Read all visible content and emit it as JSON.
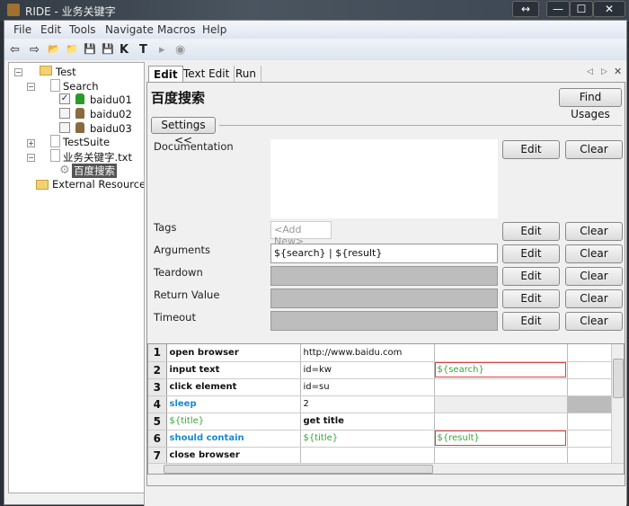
{
  "window": {
    "title": "RIDE - 业务关键字",
    "buttons": [
      "↔",
      "—",
      "☐",
      "✕"
    ]
  },
  "menu": [
    "File",
    "Edit",
    "Tools",
    "Navigate",
    "Macros",
    "Help"
  ],
  "toolbar": {
    "icons": [
      "back-arrow",
      "forward-arrow",
      "open-folder",
      "open-directory",
      "save",
      "save-all",
      "search-keywords",
      "search-tests",
      "run",
      "stop"
    ],
    "glyphs": [
      "⇦",
      "⇨",
      "📂",
      "📁",
      "💾",
      "💾",
      "K",
      "T",
      "▸",
      "◉"
    ]
  },
  "tree": {
    "root": "Test",
    "search": "Search",
    "tests": [
      {
        "name": "baidu01",
        "checked": true
      },
      {
        "name": "baidu02",
        "checked": false
      },
      {
        "name": "baidu03",
        "checked": false
      }
    ],
    "testsuite": "TestSuite",
    "resource": "业务关键字.txt",
    "keyword": "百度搜索",
    "external": "External Resources"
  },
  "tabs": [
    "Edit",
    "Text Edit",
    "Run"
  ],
  "editor": {
    "title": "百度搜索",
    "find_usages": "Find Usages",
    "settings": "Settings <<",
    "edit": "Edit",
    "clear": "Clear",
    "fields": {
      "documentation": "Documentation",
      "tags": "Tags",
      "tags_placeholder": "<Add New>",
      "arguments": "Arguments",
      "arguments_value": "${search} | ${result}",
      "teardown": "Teardown",
      "return_value": "Return Value",
      "timeout": "Timeout"
    }
  },
  "grid": {
    "rows": [
      {
        "n": "1",
        "c": [
          "open browser",
          "http://www.baidu.com",
          "",
          ""
        ]
      },
      {
        "n": "2",
        "c": [
          "input text",
          "id=kw",
          "${search}",
          ""
        ]
      },
      {
        "n": "3",
        "c": [
          "click element",
          "id=su",
          "",
          ""
        ]
      },
      {
        "n": "4",
        "c": [
          "sleep",
          "2",
          "",
          ""
        ]
      },
      {
        "n": "5",
        "c": [
          "${title}",
          "get title",
          "",
          ""
        ]
      },
      {
        "n": "6",
        "c": [
          "should contain",
          "${title}",
          "${result}",
          ""
        ]
      },
      {
        "n": "7",
        "c": [
          "close browser",
          "",
          "",
          ""
        ]
      }
    ]
  },
  "colors": {
    "builtin_keyword": "#1a88d0",
    "variable": "#3aa53a",
    "error_outline": "#e04040"
  }
}
